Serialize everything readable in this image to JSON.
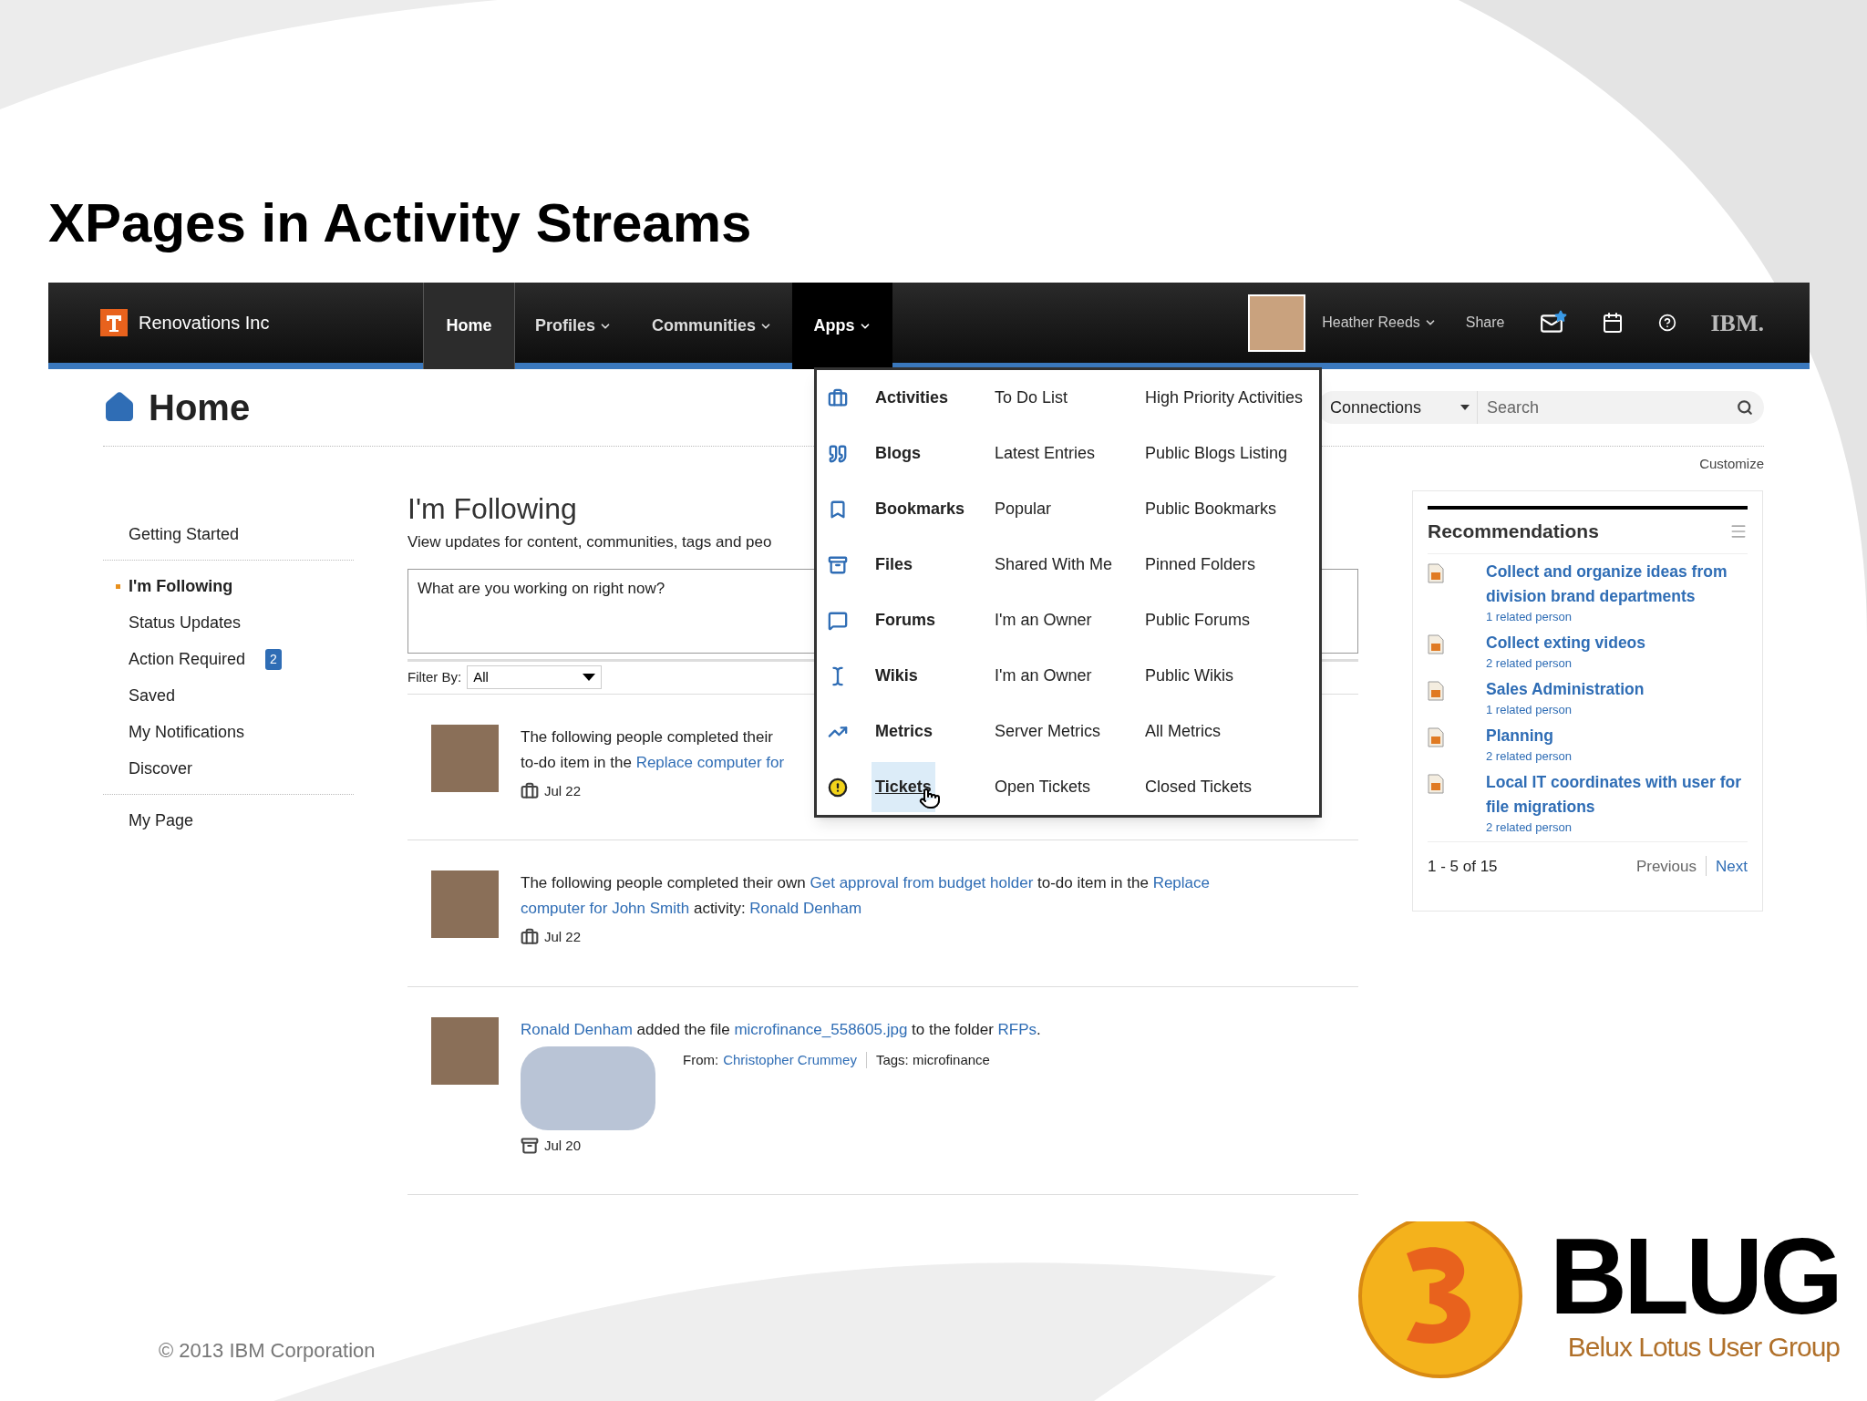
{
  "slide": {
    "title": "XPages in Activity Streams",
    "footer": "© 2013 IBM Corporation",
    "logo": {
      "mark": "BLUG",
      "tagline": "Belux Lotus User Group"
    }
  },
  "navbar": {
    "brand": "Renovations Inc",
    "tabs": [
      {
        "label": "Home",
        "selected": true,
        "open": false,
        "caret": false
      },
      {
        "label": "Profiles",
        "selected": false,
        "open": false,
        "caret": true
      },
      {
        "label": "Communities",
        "selected": false,
        "open": false,
        "caret": true
      },
      {
        "label": "Apps",
        "selected": false,
        "open": true,
        "caret": true
      }
    ],
    "user": "Heather Reeds",
    "share": "Share",
    "vendor": "IBM."
  },
  "page_header": {
    "title": "Home",
    "scope": "Connections",
    "search_placeholder": "Search",
    "customize": "Customize"
  },
  "sidebar": {
    "groups": [
      [
        {
          "label": "Getting Started",
          "selected": false
        }
      ],
      [
        {
          "label": "I'm Following",
          "selected": true
        },
        {
          "label": "Status Updates",
          "selected": false
        },
        {
          "label": "Action Required",
          "selected": false,
          "badge": "2"
        },
        {
          "label": "Saved",
          "selected": false
        },
        {
          "label": "My Notifications",
          "selected": false
        },
        {
          "label": "Discover",
          "selected": false
        }
      ],
      [
        {
          "label": "My Page",
          "selected": false
        }
      ]
    ]
  },
  "stream": {
    "title": "I'm Following",
    "description": "View updates for content, communities, tags and peo",
    "composer_placeholder": "What are you working on right now?",
    "filter_label": "Filter By:",
    "filter_value": "All",
    "entries": [
      {
        "kind": "activity",
        "lines": [
          [
            {
              "text": "The following people completed their",
              "link": false
            }
          ],
          [
            {
              "text": "to-do item in the ",
              "link": false
            },
            {
              "text": "Replace computer for",
              "link": true
            }
          ]
        ],
        "date": "Jul 22"
      },
      {
        "kind": "activity",
        "lines": [
          [
            {
              "text": "The following people completed their own ",
              "link": false
            },
            {
              "text": "Get approval from budget holder",
              "link": true
            },
            {
              "text": " to-do item in the ",
              "link": false
            },
            {
              "text": "Replace",
              "link": true
            }
          ],
          [
            {
              "text": "computer for John Smith",
              "link": true
            },
            {
              "text": " activity: ",
              "link": false
            },
            {
              "text": "Ronald Denham",
              "link": true
            }
          ]
        ],
        "date": "Jul 22"
      },
      {
        "kind": "file",
        "lines": [
          [
            {
              "text": "Ronald Denham",
              "link": true
            },
            {
              "text": " added the file ",
              "link": false
            },
            {
              "text": "microfinance_558605.jpg",
              "link": true
            },
            {
              "text": " to the folder ",
              "link": false
            },
            {
              "text": "RFPs",
              "link": true
            },
            {
              "text": ".",
              "link": false
            }
          ]
        ],
        "from_label": "From:",
        "from": "Christopher Crummey",
        "tags": "Tags: microfinance",
        "date": "Jul 20"
      }
    ]
  },
  "apps_menu": {
    "rows": [
      {
        "kind": "activities",
        "label": "Activities",
        "links": [
          "To Do List",
          "High Priority Activities"
        ],
        "selected": false
      },
      {
        "kind": "blogs",
        "label": "Blogs",
        "links": [
          "Latest Entries",
          "Public Blogs Listing"
        ],
        "selected": false
      },
      {
        "kind": "bookmarks",
        "label": "Bookmarks",
        "links": [
          "Popular",
          "Public Bookmarks"
        ],
        "selected": false
      },
      {
        "kind": "files",
        "label": "Files",
        "links": [
          "Shared With Me",
          "Pinned Folders"
        ],
        "selected": false
      },
      {
        "kind": "forums",
        "label": "Forums",
        "links": [
          "I'm an Owner",
          "Public Forums"
        ],
        "selected": false
      },
      {
        "kind": "wikis",
        "label": "Wikis",
        "links": [
          "I'm an Owner",
          "Public Wikis"
        ],
        "selected": false
      },
      {
        "kind": "metrics",
        "label": "Metrics",
        "links": [
          "Server Metrics",
          "All Metrics"
        ],
        "selected": false
      },
      {
        "kind": "tickets",
        "label": "Tickets",
        "links": [
          "Open Tickets",
          "Closed Tickets"
        ],
        "selected": true
      }
    ]
  },
  "recommendations": {
    "title": "Recommendations",
    "items": [
      {
        "title": "Collect and organize ideas from division brand departments",
        "meta": "1 related person"
      },
      {
        "title": "Collect exting videos",
        "meta": "2 related person"
      },
      {
        "title": "Sales Administration",
        "meta": "1 related person"
      },
      {
        "title": "Planning",
        "meta": "2 related person"
      },
      {
        "title": "Local IT coordinates with user for file migrations",
        "meta": "2 related person"
      }
    ],
    "range": "1 - 5 of 15",
    "pager": [
      {
        "label": "Previous",
        "disabled": true
      },
      {
        "label": "Next",
        "disabled": false
      }
    ]
  }
}
